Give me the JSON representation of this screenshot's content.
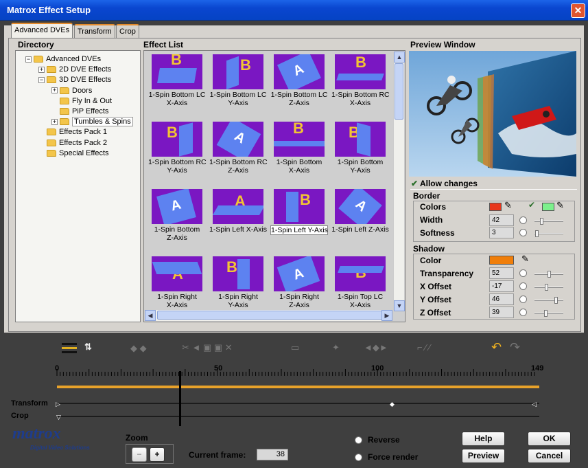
{
  "title": "Matrox Effect Setup",
  "tabs": [
    "Advanced DVEs",
    "Transform",
    "Crop"
  ],
  "directory": {
    "heading": "Directory",
    "items": [
      {
        "label": "Advanced DVEs",
        "level": 0,
        "expander": "−"
      },
      {
        "label": "2D DVE Effects",
        "level": 1,
        "expander": "+"
      },
      {
        "label": "3D DVE Effects",
        "level": 1,
        "expander": "−"
      },
      {
        "label": "Doors",
        "level": 2,
        "expander": "+"
      },
      {
        "label": "Fly In & Out",
        "level": 2,
        "expander": ""
      },
      {
        "label": "PiP Effects",
        "level": 2,
        "expander": ""
      },
      {
        "label": "Tumbles & Spins",
        "level": 2,
        "expander": "+",
        "selected": true
      },
      {
        "label": "Effects Pack 1",
        "level": 1,
        "expander": ""
      },
      {
        "label": "Effects Pack 2",
        "level": 1,
        "expander": ""
      },
      {
        "label": "Special Effects",
        "level": 1,
        "expander": ""
      }
    ]
  },
  "effect_list": {
    "heading": "Effect List",
    "items": [
      {
        "l1": "1-Spin Bottom LC",
        "l2": "X-Axis"
      },
      {
        "l1": "1-Spin Bottom LC",
        "l2": "Y-Axis"
      },
      {
        "l1": "1-Spin Bottom LC",
        "l2": "Z-Axis"
      },
      {
        "l1": "1-Spin Bottom RC",
        "l2": "X-Axis"
      },
      {
        "l1": "1-Spin Bottom RC",
        "l2": "Y-Axis"
      },
      {
        "l1": "1-Spin Bottom RC",
        "l2": "Z-Axis"
      },
      {
        "l1": "1-Spin Bottom",
        "l2": "X-Axis"
      },
      {
        "l1": "1-Spin Bottom",
        "l2": "Y-Axis"
      },
      {
        "l1": "1-Spin Bottom",
        "l2": "Z-Axis"
      },
      {
        "l1": "1-Spin Left X-Axis",
        "l2": ""
      },
      {
        "l1": "1-Spin Left Y-Axis",
        "l2": "",
        "selected": true
      },
      {
        "l1": "1-Spin Left Z-Axis",
        "l2": ""
      },
      {
        "l1": "1-Spin Right",
        "l2": "X-Axis"
      },
      {
        "l1": "1-Spin Right",
        "l2": "Y-Axis"
      },
      {
        "l1": "1-Spin Right",
        "l2": "Z-Axis"
      },
      {
        "l1": "1-Spin Top LC",
        "l2": "X-Axis"
      }
    ],
    "thumb_glyphs": [
      "B",
      "B",
      "A",
      "B",
      "B",
      "A",
      "B",
      "B",
      "A",
      "A",
      "B",
      "A",
      "A",
      "B",
      "A",
      "B"
    ]
  },
  "preview": {
    "heading": "Preview Window",
    "allow_changes": "Allow changes"
  },
  "border": {
    "heading": "Border",
    "colors_label": "Colors",
    "color1": "#e8361c",
    "color2": "#7cf08c",
    "width_label": "Width",
    "width_value": "42",
    "softness_label": "Softness",
    "softness_value": "3"
  },
  "shadow": {
    "heading": "Shadow",
    "color_label": "Color",
    "color": "#f07e0a",
    "transparency_label": "Transparency",
    "transparency_value": "52",
    "xoffset_label": "X Offset",
    "xoffset_value": "-17",
    "yoffset_label": "Y Offset",
    "yoffset_value": "46",
    "zoffset_label": "Z Offset",
    "zoffset_value": "39"
  },
  "timeline": {
    "ticks": [
      "0",
      "50",
      "100",
      "149"
    ],
    "tracks": [
      "Transform",
      "Crop"
    ]
  },
  "footer": {
    "logo": "matrox",
    "logo_sub": "Digital Video Solutions",
    "zoom_label": "Zoom",
    "zoom_minus": "−",
    "zoom_plus": "+",
    "current_frame_label": "Current frame:",
    "current_frame_value": "38",
    "reverse": "Reverse",
    "force_render": "Force render",
    "help": "Help",
    "ok": "OK",
    "preview": "Preview",
    "cancel": "Cancel"
  }
}
